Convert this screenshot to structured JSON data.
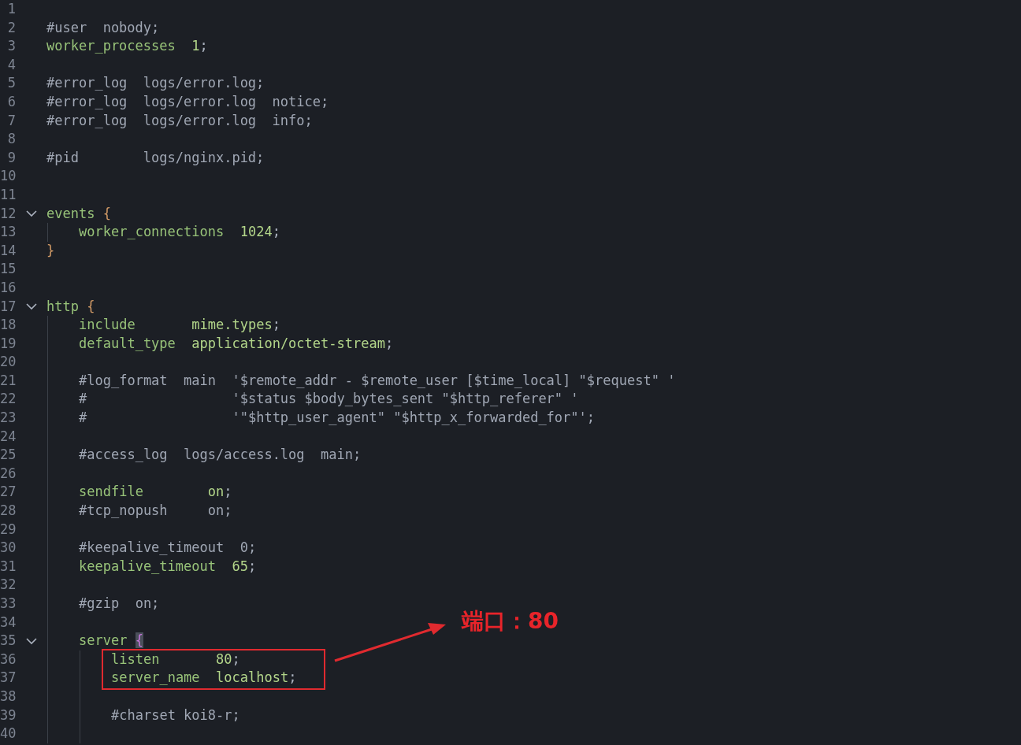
{
  "editor": {
    "lines": [
      {
        "number": "1"
      },
      {
        "number": "2",
        "tokens": [
          {
            "kind": "comment",
            "text": "#user  nobody;"
          }
        ]
      },
      {
        "number": "3",
        "tokens": [
          {
            "kind": "directive",
            "text": "worker_processes"
          },
          {
            "kind": "value",
            "text": "  1"
          },
          {
            "kind": "punct",
            "text": ";"
          }
        ]
      },
      {
        "number": "4"
      },
      {
        "number": "5",
        "tokens": [
          {
            "kind": "comment",
            "text": "#error_log  logs/error.log;"
          }
        ]
      },
      {
        "number": "6",
        "tokens": [
          {
            "kind": "comment",
            "text": "#error_log  logs/error.log  notice;"
          }
        ]
      },
      {
        "number": "7",
        "tokens": [
          {
            "kind": "comment",
            "text": "#error_log  logs/error.log  info;"
          }
        ]
      },
      {
        "number": "8"
      },
      {
        "number": "9",
        "tokens": [
          {
            "kind": "comment",
            "text": "#pid        logs/nginx.pid;"
          }
        ]
      },
      {
        "number": "10"
      },
      {
        "number": "11"
      },
      {
        "number": "12",
        "expanded": true,
        "tokens": [
          {
            "kind": "directive",
            "text": "events"
          },
          {
            "kind": "brace",
            "text": " {"
          }
        ],
        "children": [
          {
            "number": "13",
            "tokens": [
              {
                "kind": "directive",
                "text": "worker_connections"
              },
              {
                "kind": "value",
                "text": "  1024"
              },
              {
                "kind": "punct",
                "text": ";"
              }
            ]
          }
        ]
      },
      {
        "number": "14",
        "tokens": [
          {
            "kind": "brace",
            "text": "}"
          }
        ]
      },
      {
        "number": "15"
      },
      {
        "number": "16"
      },
      {
        "number": "17",
        "expanded": true,
        "tokens": [
          {
            "kind": "directive",
            "text": "http"
          },
          {
            "kind": "brace",
            "text": " {"
          }
        ],
        "children": [
          {
            "number": "18",
            "tokens": [
              {
                "kind": "directive",
                "text": "include"
              },
              {
                "kind": "value",
                "text": "       mime.types"
              },
              {
                "kind": "punct",
                "text": ";"
              }
            ]
          },
          {
            "number": "19",
            "tokens": [
              {
                "kind": "directive",
                "text": "default_type"
              },
              {
                "kind": "value",
                "text": "  application/octet-stream"
              },
              {
                "kind": "punct",
                "text": ";"
              }
            ]
          },
          {
            "number": "20"
          },
          {
            "number": "21",
            "tokens": [
              {
                "kind": "comment",
                "text": "#log_format  main  '$remote_addr - $remote_user [$time_local] \"$request\" '"
              }
            ]
          },
          {
            "number": "22",
            "tokens": [
              {
                "kind": "comment",
                "text": "#                  '$status $body_bytes_sent \"$http_referer\" '"
              }
            ]
          },
          {
            "number": "23",
            "tokens": [
              {
                "kind": "comment",
                "text": "#                  '\"$http_user_agent\" \"$http_x_forwarded_for\"';"
              }
            ]
          },
          {
            "number": "24"
          },
          {
            "number": "25",
            "tokens": [
              {
                "kind": "comment",
                "text": "#access_log  logs/access.log  main;"
              }
            ]
          },
          {
            "number": "26"
          },
          {
            "number": "27",
            "tokens": [
              {
                "kind": "directive",
                "text": "sendfile"
              },
              {
                "kind": "value",
                "text": "        on"
              },
              {
                "kind": "punct",
                "text": ";"
              }
            ]
          },
          {
            "number": "28",
            "tokens": [
              {
                "kind": "comment",
                "text": "#tcp_nopush     on;"
              }
            ]
          },
          {
            "number": "29"
          },
          {
            "number": "30",
            "tokens": [
              {
                "kind": "comment",
                "text": "#keepalive_timeout  0;"
              }
            ]
          },
          {
            "number": "31",
            "tokens": [
              {
                "kind": "directive",
                "text": "keepalive_timeout"
              },
              {
                "kind": "value",
                "text": "  65"
              },
              {
                "kind": "punct",
                "text": ";"
              }
            ]
          },
          {
            "number": "32"
          },
          {
            "number": "33",
            "tokens": [
              {
                "kind": "comment",
                "text": "#gzip  on;"
              }
            ]
          },
          {
            "number": "34"
          },
          {
            "number": "35",
            "expanded": true,
            "tokens": [
              {
                "kind": "directive",
                "text": "server"
              },
              {
                "kind": "brace-match",
                "text": "{"
              }
            ],
            "children": [
              {
                "number": "36",
                "tokens": [
                  {
                    "kind": "directive",
                    "text": "listen"
                  },
                  {
                    "kind": "value",
                    "text": "       80"
                  },
                  {
                    "kind": "punct",
                    "text": ";"
                  }
                ]
              },
              {
                "number": "37",
                "tokens": [
                  {
                    "kind": "directive",
                    "text": "server_name"
                  },
                  {
                    "kind": "value",
                    "text": "  localhost"
                  },
                  {
                    "kind": "punct",
                    "text": ";"
                  }
                ]
              },
              {
                "number": "38"
              },
              {
                "number": "39",
                "tokens": [
                  {
                    "kind": "comment",
                    "text": "#charset koi8-r;"
                  }
                ]
              },
              {
                "number": "40"
              }
            ]
          }
        ]
      }
    ]
  },
  "annotation": {
    "label": "端口：80"
  }
}
